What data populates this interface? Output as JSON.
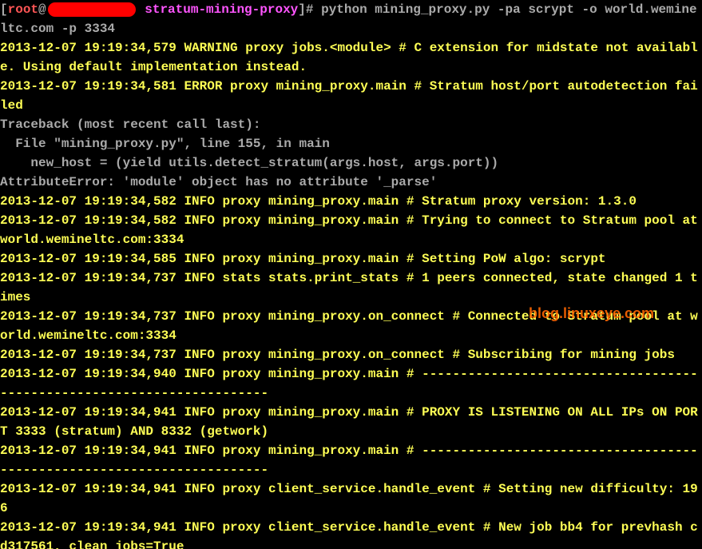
{
  "prompt": {
    "open_bracket": "[",
    "user": "root",
    "at": "@",
    "host_redacted": true,
    "dir": "stratum-mining-proxy",
    "close_bracket": "]",
    "hash": "#",
    "command": " python mining_proxy.py -pa scrypt -o world.wemineltc.com -p 3334"
  },
  "lines": {
    "l1": "2013-12-07 19:19:34,579 WARNING proxy jobs.<module> # C extension for midstate not available. Using default implementation instead.",
    "l2": "2013-12-07 19:19:34,581 ERROR proxy mining_proxy.main # Stratum host/port autodetection failed",
    "tb0": "Traceback (most recent call last):",
    "tb1": "  File \"mining_proxy.py\", line 155, in main",
    "tb2": "    new_host = (yield utils.detect_stratum(args.host, args.port))",
    "tb3": "AttributeError: 'module' object has no attribute '_parse'",
    "l3": "2013-12-07 19:19:34,582 INFO proxy mining_proxy.main # Stratum proxy version: 1.3.0",
    "l4": "2013-12-07 19:19:34,582 INFO proxy mining_proxy.main # Trying to connect to Stratum pool at world.wemineltc.com:3334",
    "l5": "2013-12-07 19:19:34,585 INFO proxy mining_proxy.main # Setting PoW algo: scrypt",
    "l6": "2013-12-07 19:19:34,737 INFO stats stats.print_stats # 1 peers connected, state changed 1 times",
    "l7": "2013-12-07 19:19:34,737 INFO proxy mining_proxy.on_connect # Connected to Stratum pool at world.wemineltc.com:3334",
    "l8": "2013-12-07 19:19:34,737 INFO proxy mining_proxy.on_connect # Subscribing for mining jobs",
    "l9a": "2013-12-07 19:19:34,940 INFO proxy mining_proxy.main # -----------------------------------------------------------------------",
    "l9b": "2013-12-07 19:19:34,941 INFO proxy mining_proxy.main # PROXY IS LISTENING ON ALL IPs ON PORT 3333 (stratum) AND 8332 (getwork)",
    "l9c": "2013-12-07 19:19:34,941 INFO proxy mining_proxy.main # -----------------------------------------------------------------------",
    "l10": "2013-12-07 19:19:34,941 INFO proxy client_service.handle_event # Setting new difficulty: 196",
    "l11": "2013-12-07 19:19:34,941 INFO proxy client_service.handle_event # New job bb4 for prevhash cd317561, clean_jobs=True"
  },
  "watermark": "blog.linuxeye.com"
}
